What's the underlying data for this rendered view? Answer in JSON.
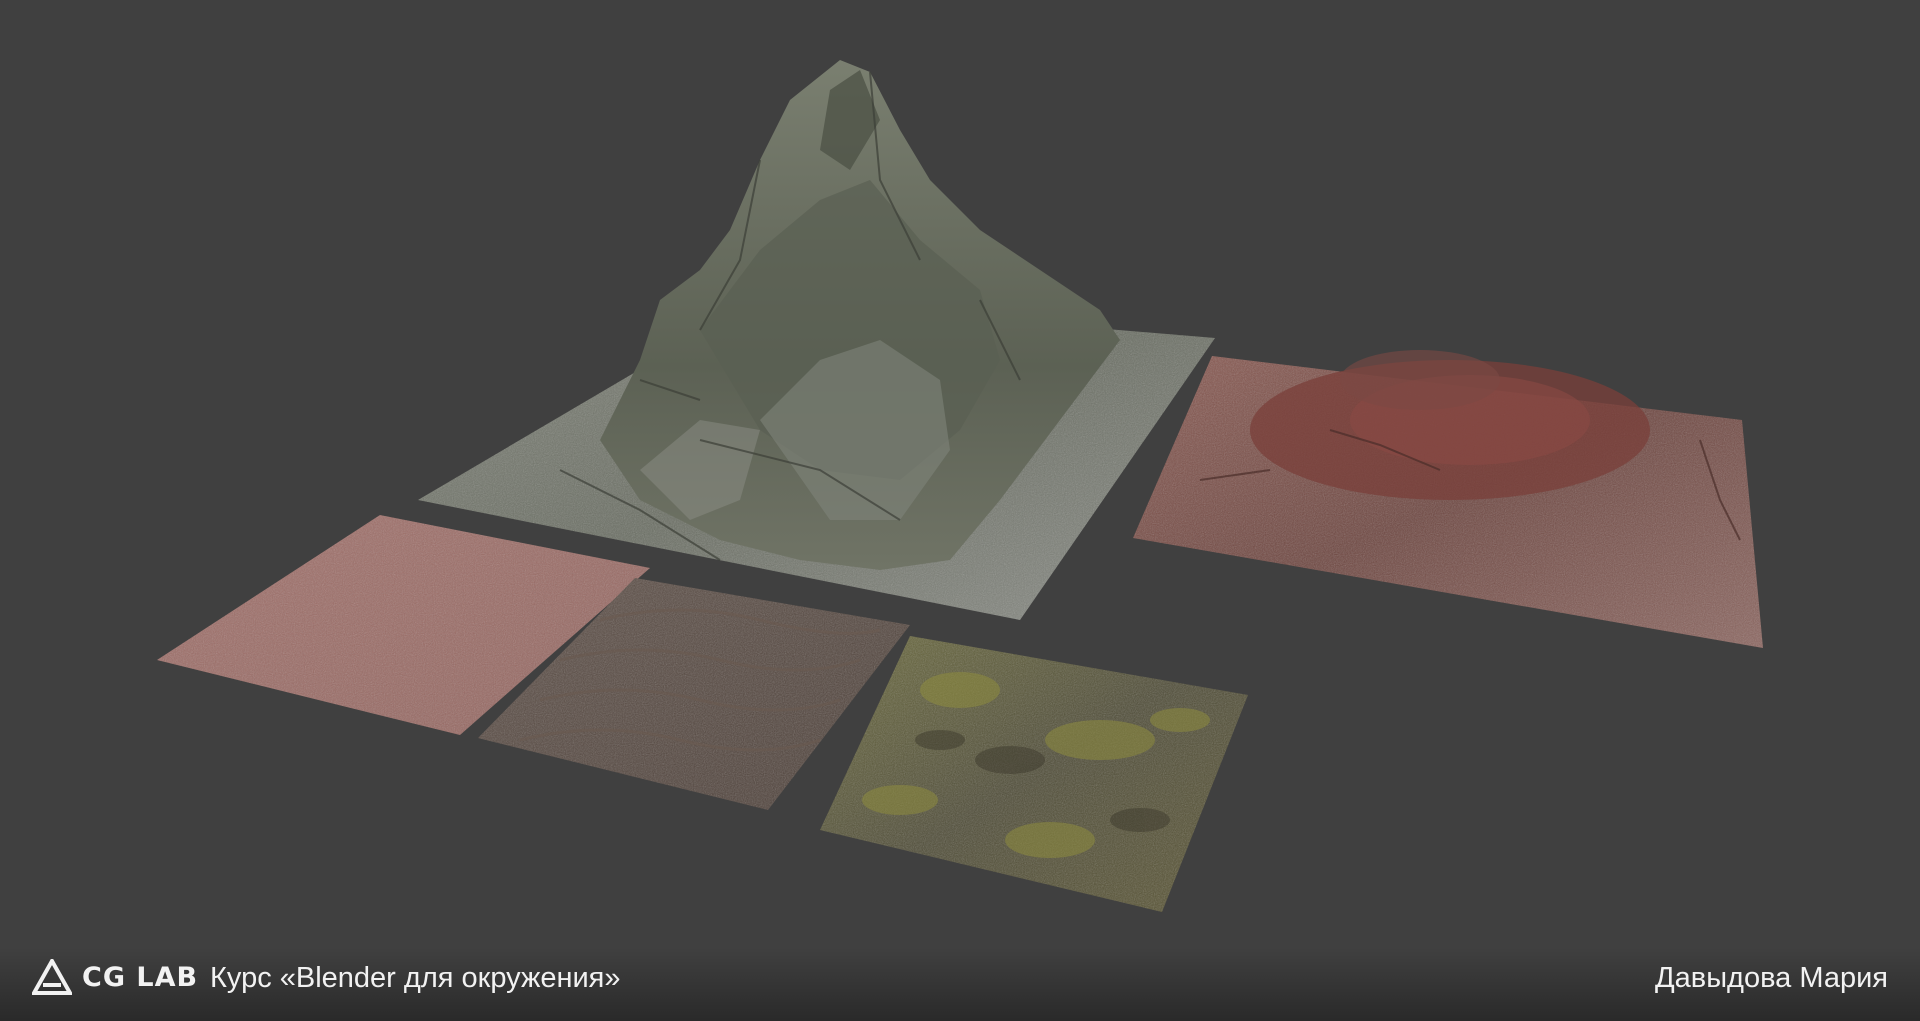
{
  "footer": {
    "brand": "CG LAB",
    "course": "Курс «Blender для окружения»",
    "author": "Давыдова Мария"
  },
  "scene": {
    "background_color": "#404040",
    "objects": [
      {
        "name": "mountain-rock",
        "description_color": "#6e7262"
      },
      {
        "name": "red-hill",
        "description_color": "#7a4a43"
      },
      {
        "name": "pink-sand-tile",
        "description_color": "#9a6a62"
      },
      {
        "name": "brown-wave-tile",
        "description_color": "#55483f"
      },
      {
        "name": "moss-rock-tile",
        "description_color": "#5b5736"
      }
    ]
  },
  "icons": {
    "logo": "cg-lab-logo-icon"
  }
}
